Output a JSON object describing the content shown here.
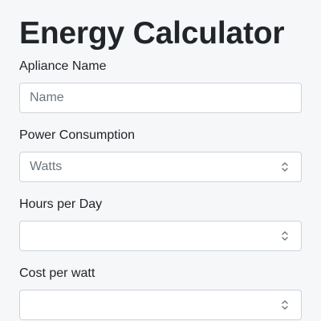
{
  "form": {
    "title": "Energy Calculator",
    "fields": [
      {
        "label": "Apliance Name",
        "placeholder": "Name",
        "value": "",
        "type": "text"
      },
      {
        "label": "Power Consumption",
        "placeholder": "Watts",
        "value": "",
        "type": "number"
      },
      {
        "label": "Hours per Day",
        "placeholder": "",
        "value": "",
        "type": "number"
      },
      {
        "label": "Cost per watt",
        "placeholder": "",
        "value": "",
        "type": "number"
      }
    ]
  },
  "icons": {
    "stepper": "chevron-up-down-icon"
  },
  "colors": {
    "background": "#f6f7f9",
    "input_border": "#ced4da",
    "text": "#212529",
    "placeholder": "#6c757d"
  }
}
